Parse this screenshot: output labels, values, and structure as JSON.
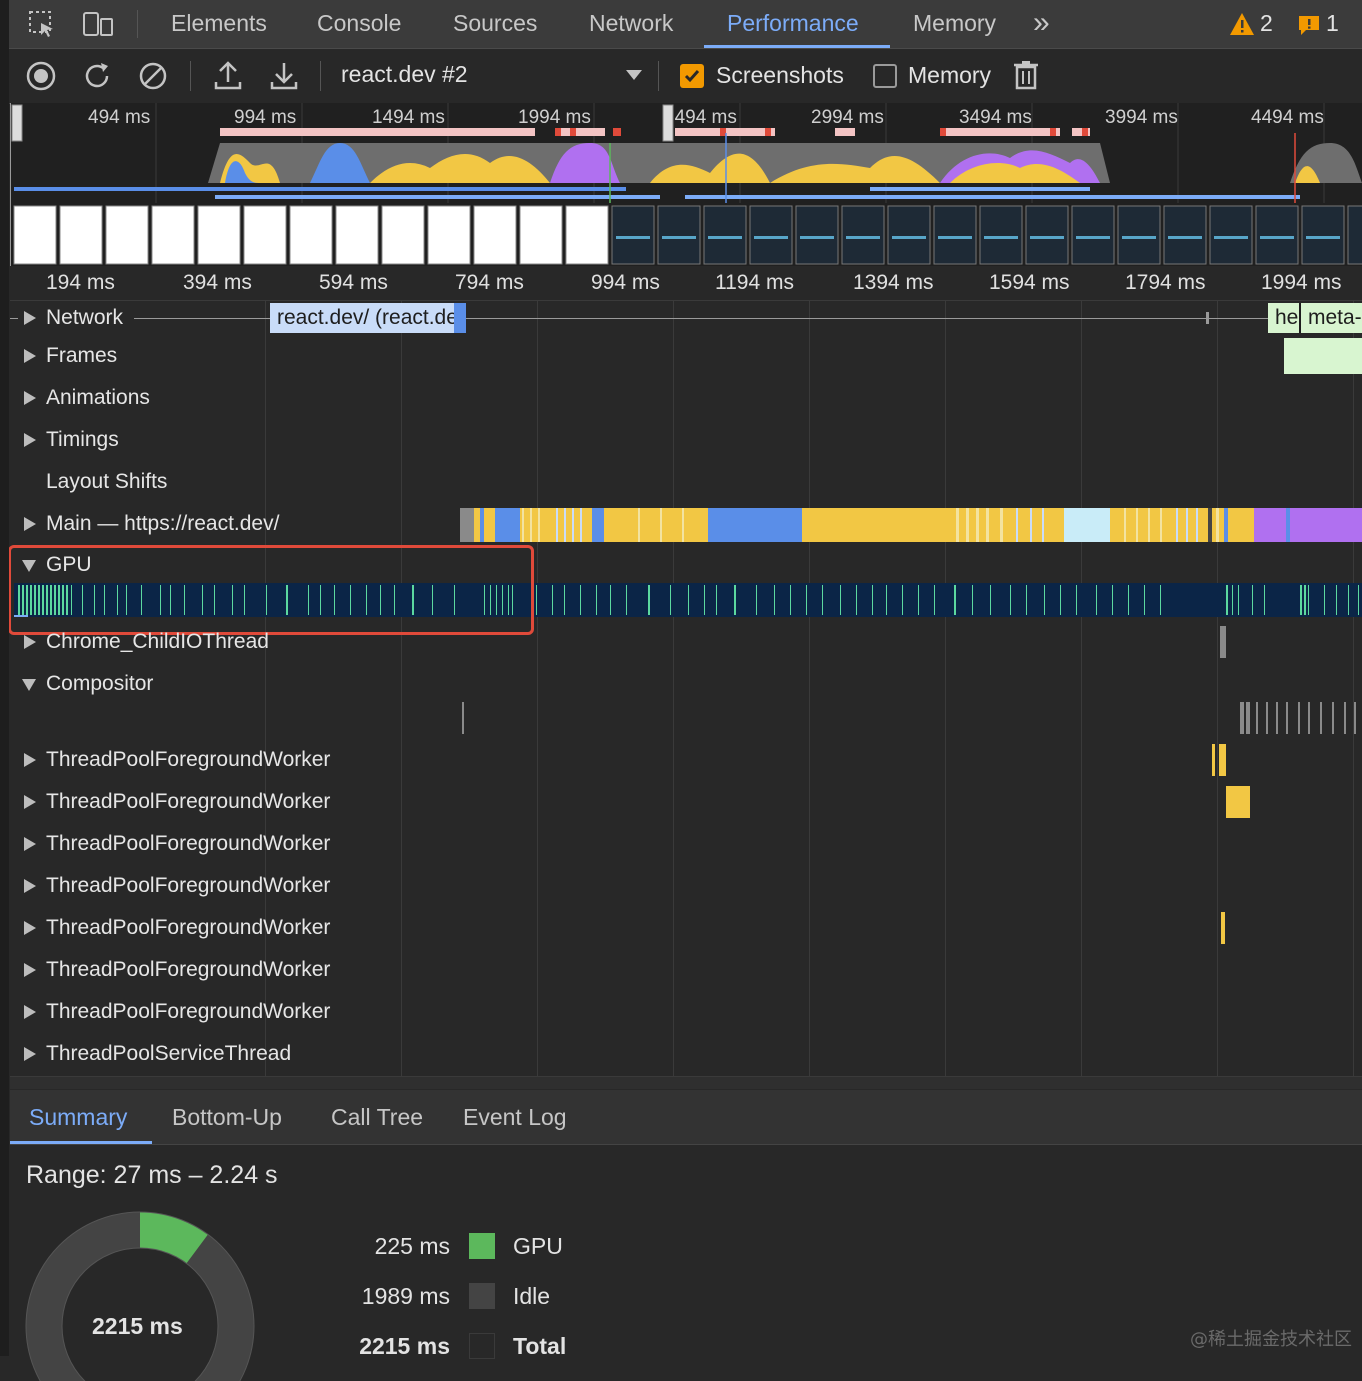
{
  "tabs": [
    "Elements",
    "Console",
    "Sources",
    "Network",
    "Performance",
    "Memory"
  ],
  "more_tabs_label": "»",
  "warnings_count": "2",
  "issues_count": "1",
  "toolbar": {
    "profile_selected": "react.dev #2",
    "screenshots_label": "Screenshots",
    "screenshots_checked": true,
    "memory_label": "Memory",
    "memory_checked": false
  },
  "overview_ruler": [
    "494 ms",
    "994 ms",
    "1494 ms",
    "1994 ms",
    "2494 ms",
    "2994 ms",
    "3494 ms",
    "3994 ms",
    "4494 ms"
  ],
  "main_ruler": [
    "194 ms",
    "394 ms",
    "594 ms",
    "794 ms",
    "994 ms",
    "1194 ms",
    "1394 ms",
    "1594 ms",
    "1794 ms",
    "1994 ms"
  ],
  "tracks": {
    "network": "Network",
    "network_request": "react.dev/ (react.de",
    "network_request_right_1": "he",
    "network_request_right_2": "meta-",
    "frames": "Frames",
    "animations": "Animations",
    "timings": "Timings",
    "layout_shifts": "Layout Shifts",
    "main": "Main — https://react.dev/",
    "gpu": "GPU",
    "childio": "Chrome_ChildIOThread",
    "compositor": "Compositor",
    "workers": [
      "ThreadPoolForegroundWorker",
      "ThreadPoolForegroundWorker",
      "ThreadPoolForegroundWorker",
      "ThreadPoolForegroundWorker",
      "ThreadPoolForegroundWorker",
      "ThreadPoolForegroundWorker",
      "ThreadPoolForegroundWorker"
    ],
    "service": "ThreadPoolServiceThread"
  },
  "bottom_tabs": [
    "Summary",
    "Bottom-Up",
    "Call Tree",
    "Event Log"
  ],
  "summary": {
    "range": "Range: 27 ms – 2.24 s",
    "total_center": "2215 ms",
    "rows": [
      {
        "value": "225 ms",
        "name": "GPU",
        "color": "#5cb85c"
      },
      {
        "value": "1989 ms",
        "name": "Idle",
        "color": "#444444"
      },
      {
        "value": "2215 ms",
        "name": "Total",
        "color": "#282828"
      }
    ],
    "gpu_fraction": 0.1016
  },
  "watermark": "@稀土掘金技术社区",
  "colors": {
    "accent": "#7cacf8",
    "scripting": "#f2c744",
    "rendering": "#b070f0",
    "loading": "#5a8ee8",
    "gpu": "#5cb85c",
    "highlight": "#e04a3a"
  }
}
